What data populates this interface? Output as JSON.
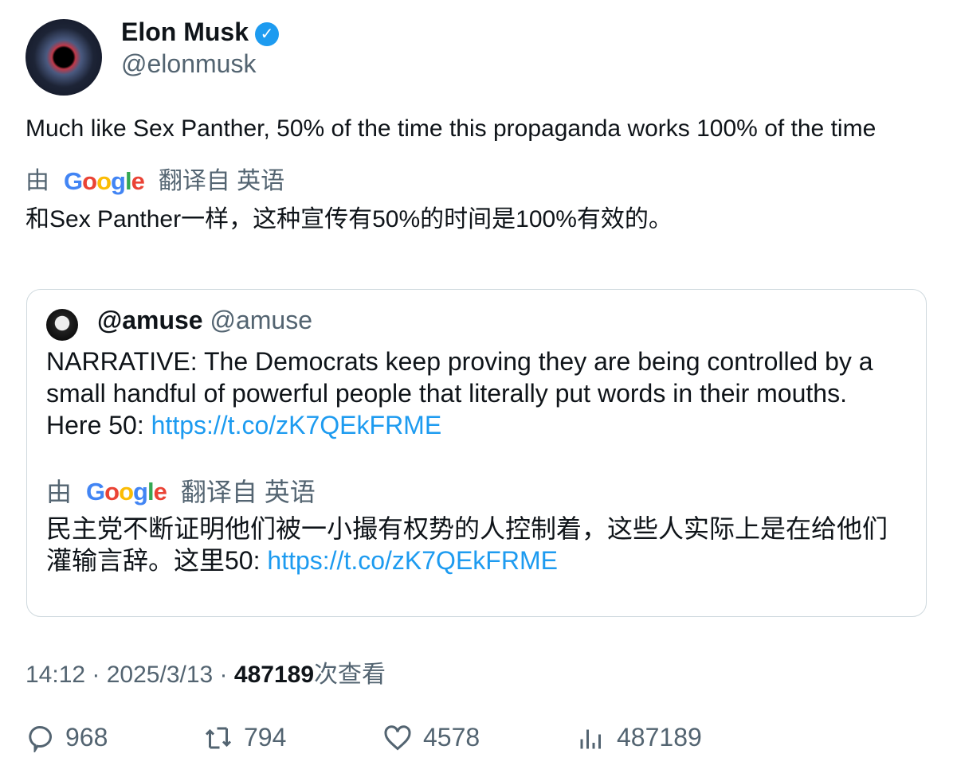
{
  "author": {
    "name": "Elon Musk",
    "handle": "@elonmusk"
  },
  "tweet": {
    "text": "Much like Sex Panther, 50% of the time this propaganda works 100% of the time",
    "translation": {
      "by": "由",
      "engine": "Google",
      "from": "翻译自 英语",
      "text": "和Sex Panther一样，这种宣传有50%的时间是100%有效的。"
    }
  },
  "quote": {
    "name": "@amuse",
    "handle": "@amuse",
    "text": "NARRATIVE: The Democrats keep proving they are being controlled by a small handful of powerful people that literally put words in their mouths. Here 50: ",
    "link": "https://t.co/zK7QEkFRME",
    "translation": {
      "by": "由",
      "engine": "Google",
      "from": "翻译自 英语",
      "text": "民主党不断证明他们被一小撮有权势的人控制着，这些人实际上是在给他们灌输言辞。这里50: ",
      "link": "https://t.co/zK7QEkFRME"
    }
  },
  "meta": {
    "time": "14:12",
    "date": "2025/3/13",
    "views": "487189",
    "views_label": "次查看"
  },
  "actions": {
    "replies": "968",
    "retweets": "794",
    "likes": "4578",
    "views": "487189"
  }
}
